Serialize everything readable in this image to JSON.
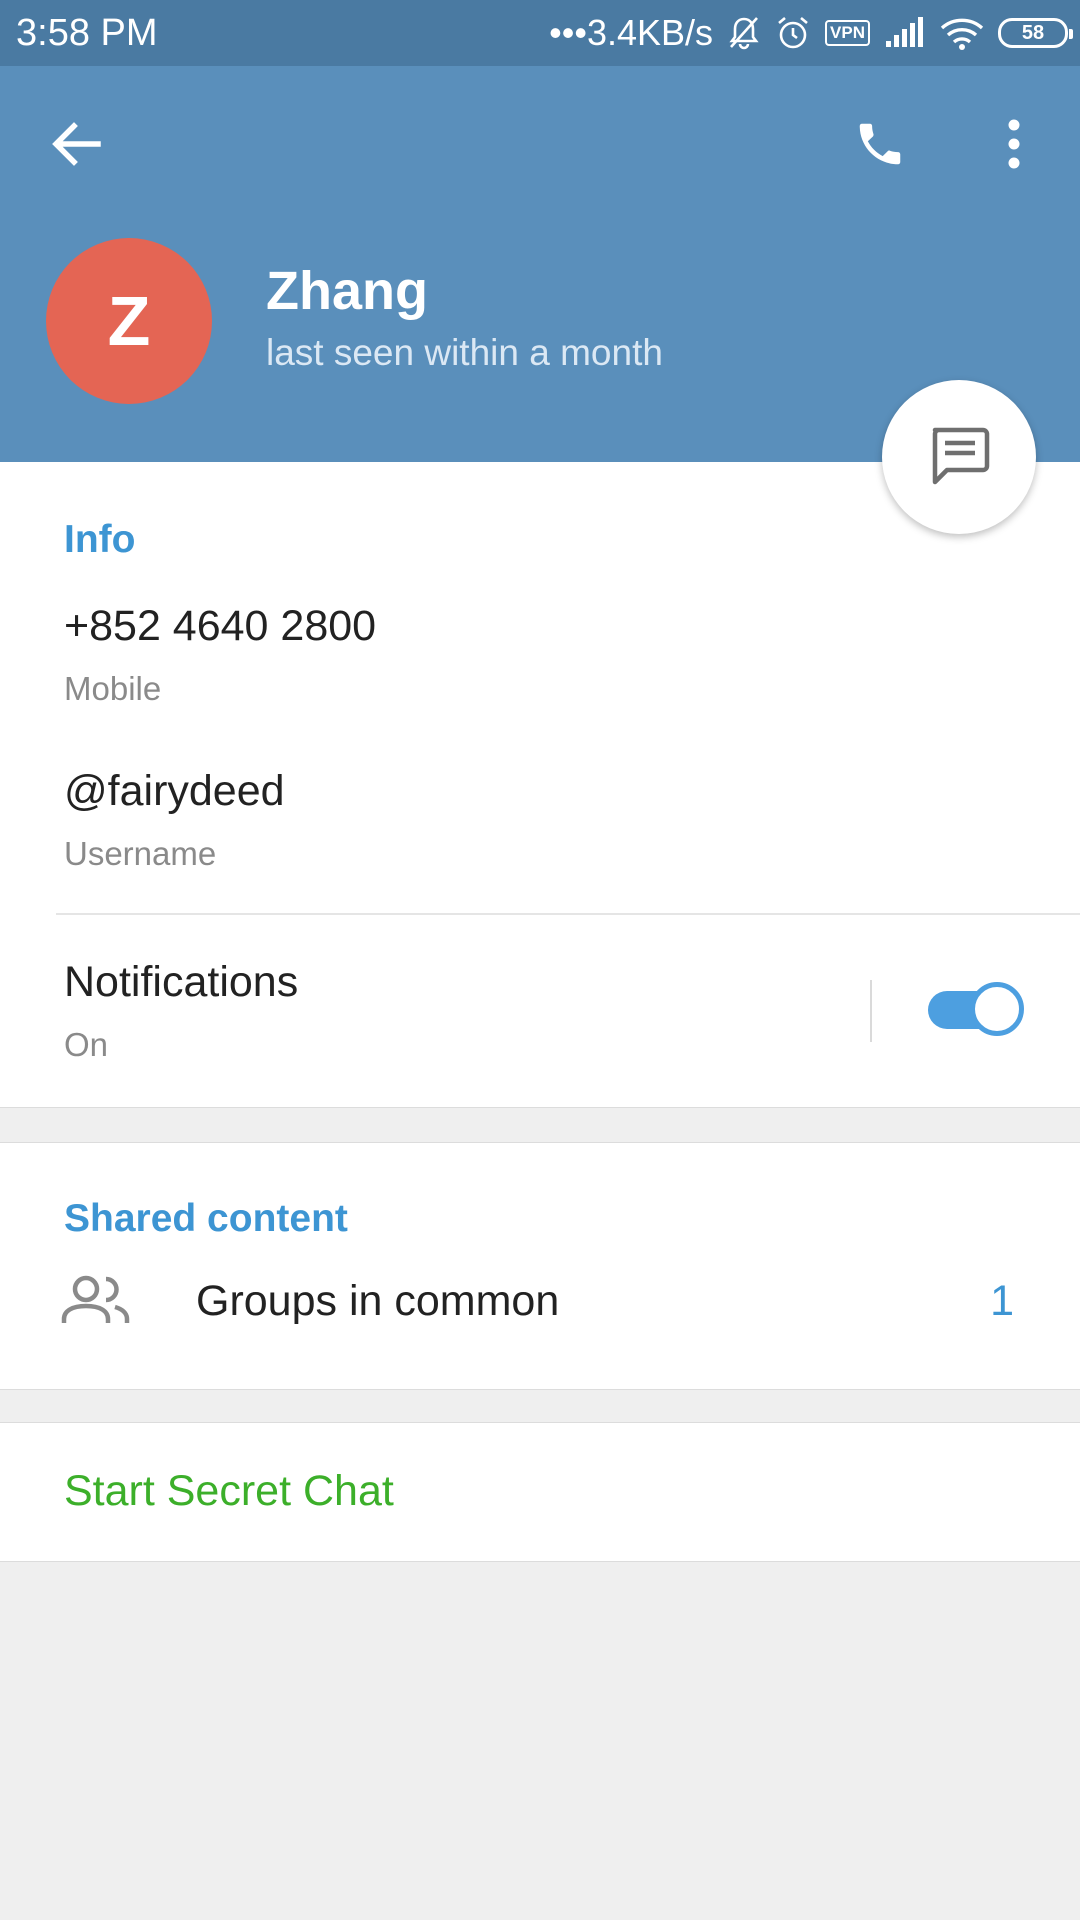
{
  "status_bar": {
    "time": "3:58 PM",
    "network_speed": "•••3.4KB/s",
    "vpn": "VPN",
    "battery": "58",
    "icons": [
      "bell-muted-icon",
      "alarm-icon",
      "vpn-icon",
      "signal-icon",
      "wifi-icon",
      "battery-icon"
    ]
  },
  "header": {
    "back_icon": "arrow-left-icon",
    "call_icon": "phone-icon",
    "more_icon": "more-vertical-icon",
    "avatar_letter": "Z",
    "name": "Zhang",
    "status": "last seen within a month",
    "fab_icon": "message-icon"
  },
  "info": {
    "section_title": "Info",
    "phone": {
      "value": "+852 4640 2800",
      "label": "Mobile"
    },
    "username": {
      "value": "@fairydeed",
      "label": "Username"
    },
    "notifications": {
      "title": "Notifications",
      "state": "On",
      "enabled": true
    }
  },
  "shared": {
    "section_title": "Shared content",
    "groups_in_common": {
      "label": "Groups in common",
      "count": "1",
      "icon": "group-icon"
    }
  },
  "secret_chat": {
    "label": "Start Secret Chat"
  },
  "colors": {
    "status_bar": "#4a7aa2",
    "header": "#5a8fbb",
    "avatar": "#e46554",
    "accent_blue": "#3d95d3",
    "toggle": "#4d9fe0",
    "secret_green": "#3caf2a",
    "background": "#efefef"
  }
}
